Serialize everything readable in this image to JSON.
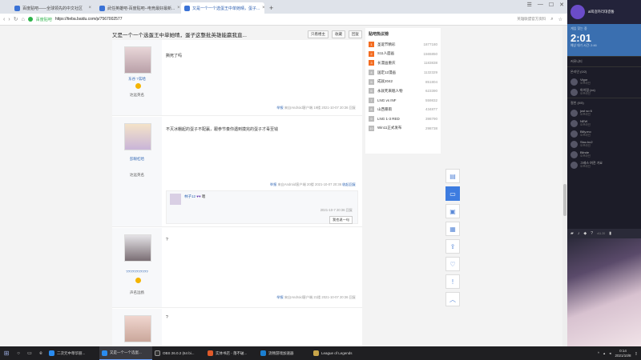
{
  "browser": {
    "tabs": [
      {
        "label": "百度贴吧——全球领先的中文社区",
        "active": false
      },
      {
        "label": "武任英雄吧-百度贴吧--电竞最好最新...",
        "active": false
      },
      {
        "label": "又是一个一个选蛋王中单她晴，蛋子...",
        "active": true
      }
    ],
    "new_tab": "+",
    "site_label": "百度贴吧",
    "url": "https://tieba.baidu.com/p/7567002577",
    "search_hint": "英雄联盟官方资料"
  },
  "thread": {
    "title": "又是一个一个选蛋王中单她晴，蛋子这整批英雄能赢我直...",
    "buttons": [
      "只看楼主",
      "收藏",
      "回复"
    ]
  },
  "posts": [
    {
      "user": "东谷 ?玄哈",
      "level": "一",
      "tag": "达远英名",
      "text": "撕死了吗",
      "meta_rep": "举报",
      "meta": "来自Android客户端  19楼  2021-10-07 20:36  回复"
    },
    {
      "user": "彭眼杠哈",
      "level": "",
      "tag": "达远英名",
      "text": "不灭冰棚起的蛋子不配赢，跟参节奏你遇到摸完的蛋子才毒至钱",
      "meta_rep": "举报",
      "meta": "来自Android客户端  20楼  2021-10-07 20:36",
      "reply_btn": "收起回复",
      "reply": {
        "user": "林子12",
        "text": "嗯",
        "time": "2021-10-7 20:36  回复",
        "btn": "我也说一句"
      }
    },
    {
      "user": "???????????",
      "level": "",
      "tag": "声名远扬",
      "text": "?",
      "meta_rep": "举报",
      "meta": "来自Android客户端  21楼  2021-10-07 20:36  回复"
    },
    {
      "user": "",
      "level": "",
      "tag": "",
      "text": "?",
      "meta_rep": "",
      "meta": ""
    }
  ],
  "sidebar": {
    "title": "贴吧热议榜",
    "items": [
      {
        "rank": "1",
        "name": "圣诞节精彩",
        "count": "1877180"
      },
      {
        "rank": "2",
        "name": "S11人面画",
        "count": "1565850"
      },
      {
        "rank": "3",
        "name": "长漫画重庆",
        "count": "1183838"
      },
      {
        "rank": "4",
        "name": "国定12漫画",
        "count": "1132329"
      },
      {
        "rank": "5",
        "name": "成就2042",
        "count": "851804"
      },
      {
        "rank": "6",
        "name": "永就死来眠人物",
        "count": "623390"
      },
      {
        "rank": "7",
        "name": "LNG vs INF",
        "count": "559832"
      },
      {
        "rank": "8",
        "name": "山西暴雨",
        "count": "434877"
      },
      {
        "rank": "9",
        "name": "LNG 1-3 RED",
        "count": "398790"
      },
      {
        "rank": "10",
        "name": "Win11正式发布",
        "count": "298738"
      }
    ]
  },
  "floating_icons": [
    "doc-icon",
    "comment-icon",
    "gift-icon",
    "chat-icon",
    "share-icon",
    "heart-icon",
    "alert-icon",
    "up-icon"
  ],
  "overlay": {
    "title": "al희걸카리대결통",
    "subtitle": "게임 찾는 중",
    "timer": "2:01",
    "since": "예상 대기 시간: 2:46",
    "sec_friends": "커뮤니티",
    "sec_online": "온라인 (0/2)",
    "sec_offline": "절친 (0/5)",
    "users": [
      {
        "name": "Vigor",
        "status": "오프라인"
      },
      {
        "name": "아이링 (xx)",
        "status": "오프라인"
      },
      {
        "name": "",
        "status": "오프라인"
      },
      {
        "name": "just so 6",
        "status": "오프라인"
      },
      {
        "name": "NEW",
        "status": "오프라인"
      },
      {
        "name": "Billy.mo",
        "status": "오프라인"
      },
      {
        "name": "Stoc.bc2",
        "status": "오프라인"
      },
      {
        "name": "Blinde",
        "status": "오프라인"
      },
      {
        "name": "그레스 여전 가요",
        "status": "오프라인"
      },
      {
        "name": "",
        "status": "오프라인"
      }
    ],
    "toolbar_time": "v11.20"
  },
  "taskbar": {
    "apps": [
      {
        "label": "二次元中草华丽...",
        "active": false
      },
      {
        "label": "又是一个一个选蛋...",
        "active": true
      },
      {
        "label": "OBS 26.0.2 (64 bi...",
        "active": false
      },
      {
        "label": "实体书店 - 落不破...",
        "active": false
      },
      {
        "label": "流畅游戏加速器",
        "active": false
      },
      {
        "label": "League of Legends",
        "active": false
      }
    ],
    "time": "0:14",
    "date": "2021/10/8"
  }
}
